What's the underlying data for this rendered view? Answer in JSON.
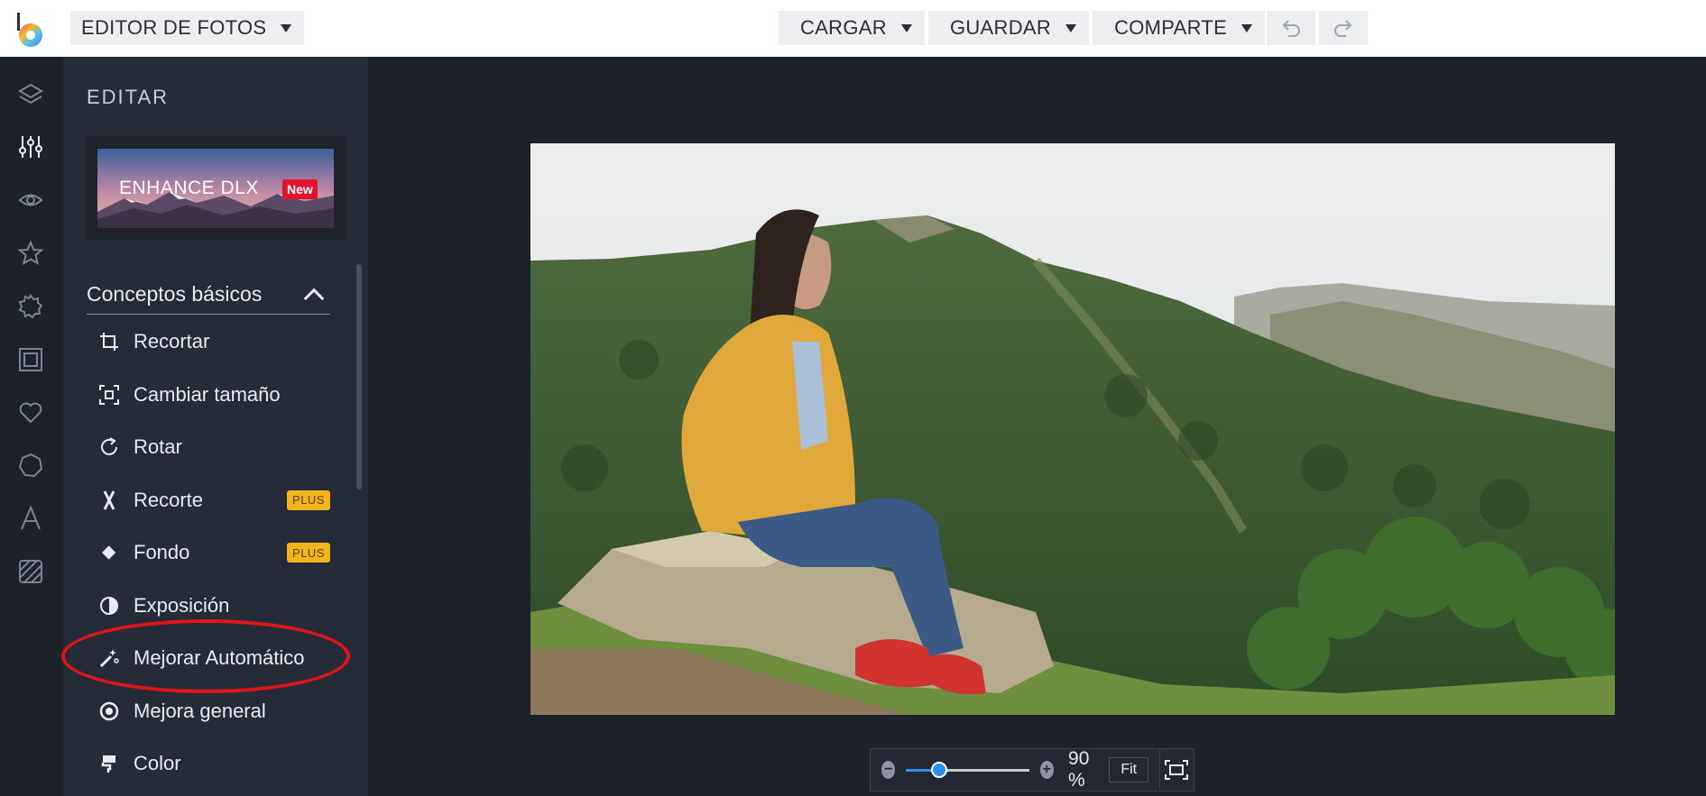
{
  "topbar": {
    "app_menu": "EDITOR DE FOTOS",
    "menus": [
      {
        "label": "CARGAR"
      },
      {
        "label": "GUARDAR"
      },
      {
        "label": "COMPARTE"
      }
    ],
    "undo_icon": "undo-icon",
    "redo_icon": "redo-icon"
  },
  "rail": {
    "items": [
      "layers-icon",
      "adjustments-icon",
      "eye-icon",
      "star-icon",
      "badge-icon",
      "frame-icon",
      "heart-icon",
      "shape-icon",
      "text-icon",
      "texture-icon"
    ],
    "active": "adjustments-icon"
  },
  "panel": {
    "title": "EDITAR",
    "promo": {
      "text": "ENHANCE DLX",
      "badge": "New"
    },
    "section": {
      "label": "Conceptos básicos"
    },
    "tools": [
      {
        "label": "Recortar",
        "icon": "crop-icon",
        "badge": ""
      },
      {
        "label": "Cambiar tamaño",
        "icon": "resize-icon",
        "badge": ""
      },
      {
        "label": "Rotar",
        "icon": "rotate-icon",
        "badge": ""
      },
      {
        "label": "Recorte",
        "icon": "cutout-icon",
        "badge": "PLUS"
      },
      {
        "label": "Fondo",
        "icon": "background-icon",
        "badge": "PLUS"
      },
      {
        "label": "Exposición",
        "icon": "exposure-icon",
        "badge": ""
      },
      {
        "label": "Mejorar Automático",
        "icon": "magic-wand-icon",
        "badge": ""
      },
      {
        "label": "Mejora general",
        "icon": "enhance-icon",
        "badge": ""
      },
      {
        "label": "Color",
        "icon": "color-icon",
        "badge": ""
      }
    ],
    "highlighted_tool": "Mejorar Automático"
  },
  "zoom": {
    "value": "90 %",
    "level": 0.27,
    "fit_label": "Fit"
  },
  "colors": {
    "accent": "#2f8ff0",
    "plus_badge": "#f2b51e",
    "new_badge": "#e2142d",
    "highlight_ring": "#e0141c"
  }
}
